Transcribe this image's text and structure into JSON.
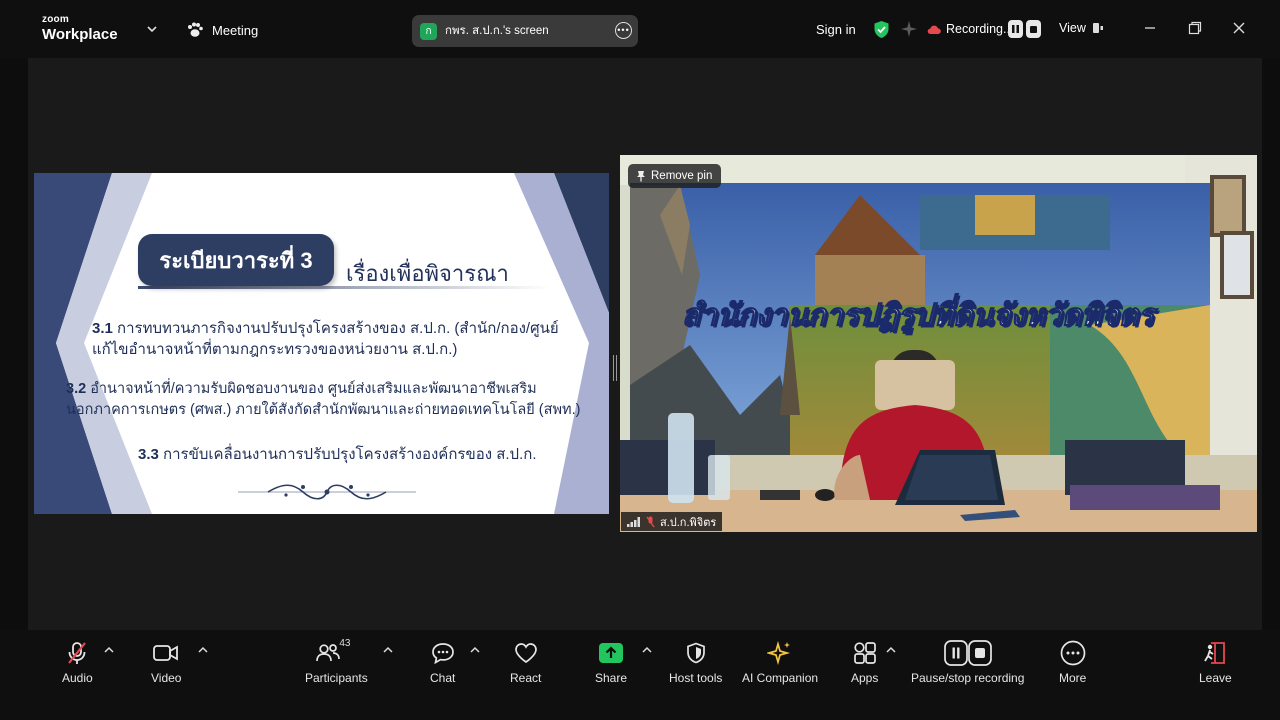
{
  "app": {
    "logo_small": "zoom",
    "logo_main": "Workplace",
    "meeting_label": "Meeting"
  },
  "share_pill": {
    "avatar_letter": "ก",
    "title": "กพร. ส.ป.ก.'s screen"
  },
  "header": {
    "sign_in": "Sign in",
    "recording": "Recording...",
    "view": "View"
  },
  "slide": {
    "title": "ระเบียบวาระที่ 3",
    "subtitle": "เรื่องเพื่อพิจารณา",
    "items": [
      {
        "num": "3.1",
        "line1": "การทบทวนภารกิจงานปรับปรุงโครงสร้างของ ส.ป.ก. (สำนัก/กอง/ศูนย์",
        "line2": "แก้ไขอำนาจหน้าที่ตามกฎกระทรวงของหน่วยงาน ส.ป.ก.)"
      },
      {
        "num": "3.2",
        "line1": "อำนาจหน้าที่/ความรับผิดชอบงานของ ศูนย์ส่งเสริมและพัฒนาอาชีพเสริม",
        "line2": "นอกภาคการเกษตร (ศพส.) ภายใต้สังกัดสำนักพัฒนาและถ่ายทอดเทคโนโลยี (สพท.)"
      },
      {
        "num": "3.3",
        "line1": "การขับเคลื่อนงานการปรับปรุงโครงสร้างองค์กรของ ส.ป.ก.",
        "line2": ""
      }
    ]
  },
  "video": {
    "remove_pin": "Remove pin",
    "participant_name": "ส.ป.ก.พิจิตร",
    "banner_text": "สำนักงานการปฏิรูปที่ดินจังหวัดพิจิตร"
  },
  "toolbar": {
    "audio": "Audio",
    "video": "Video",
    "participants": "Participants",
    "participants_count": "43",
    "chat": "Chat",
    "react": "React",
    "share": "Share",
    "host_tools": "Host tools",
    "ai_companion": "AI Companion",
    "apps": "Apps",
    "pause_stop": "Pause/stop recording",
    "more": "More",
    "leave": "Leave"
  },
  "colors": {
    "share_green": "#22c55e",
    "secure_green": "#22c55e",
    "leave_red": "#e5484d",
    "slide_navy": "#2e3d62",
    "slide_band": "#a8b0cf"
  }
}
